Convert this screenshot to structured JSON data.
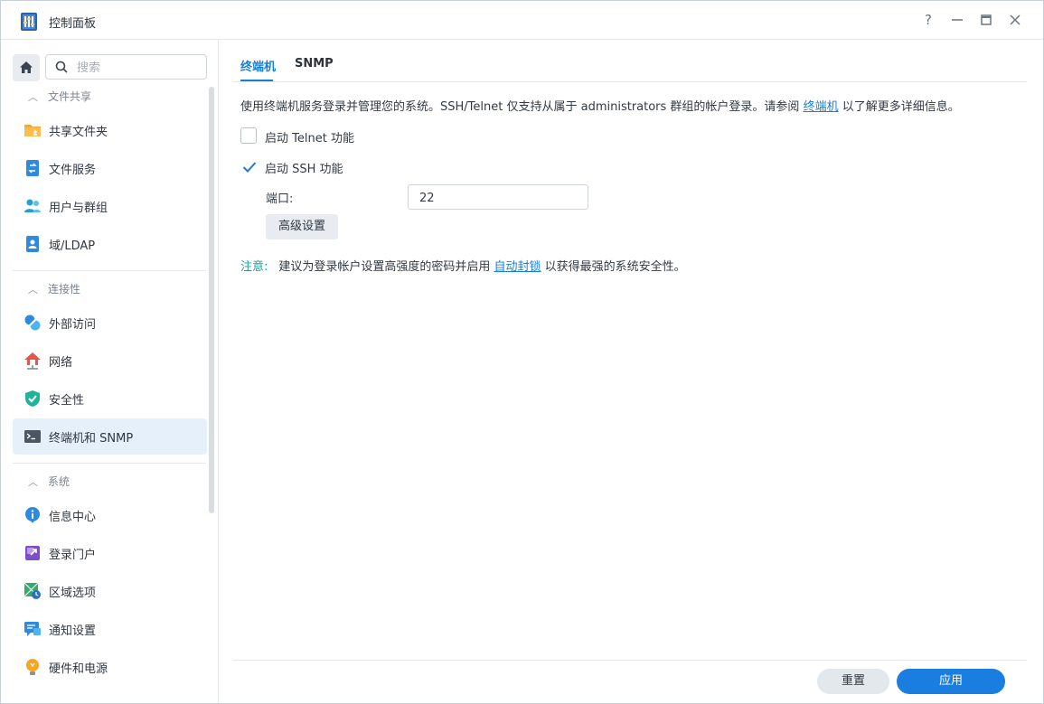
{
  "window": {
    "title": "控制面板",
    "controls": {
      "help": "?",
      "minimize": "—",
      "maximize": "□",
      "close": "✕"
    }
  },
  "sidebar": {
    "search_placeholder": "搜索",
    "groups": [
      {
        "label": "文件共享",
        "items": [
          {
            "label": "共享文件夹",
            "icon": "shared-folder-icon"
          },
          {
            "label": "文件服务",
            "icon": "file-services-icon"
          },
          {
            "label": "用户与群组",
            "icon": "users-groups-icon"
          },
          {
            "label": "域/LDAP",
            "icon": "domain-ldap-icon"
          }
        ]
      },
      {
        "label": "连接性",
        "items": [
          {
            "label": "外部访问",
            "icon": "external-access-icon"
          },
          {
            "label": "网络",
            "icon": "network-icon"
          },
          {
            "label": "安全性",
            "icon": "security-shield-icon"
          },
          {
            "label": "终端机和 SNMP",
            "icon": "terminal-icon",
            "active": true
          }
        ]
      },
      {
        "label": "系统",
        "items": [
          {
            "label": "信息中心",
            "icon": "info-center-icon"
          },
          {
            "label": "登录门户",
            "icon": "login-portal-icon"
          },
          {
            "label": "区域选项",
            "icon": "regional-options-icon"
          },
          {
            "label": "通知设置",
            "icon": "notification-icon"
          },
          {
            "label": "硬件和电源",
            "icon": "hardware-power-icon"
          }
        ]
      }
    ]
  },
  "tabs": [
    {
      "label": "终端机",
      "active": true
    },
    {
      "label": "SNMP",
      "active": false
    }
  ],
  "terminal": {
    "desc_before": "使用终端机服务登录并管理您的系统。SSH/Telnet 仅支持从属于 administrators 群组的帐户登录。请参阅 ",
    "desc_link": "终端机",
    "desc_after": " 以了解更多详细信息。",
    "telnet": {
      "label": "启动 Telnet 功能",
      "checked": false
    },
    "ssh": {
      "label": "启动 SSH 功能",
      "checked": true
    },
    "port_label": "端口:",
    "port_value": "22",
    "advanced_button": "高级设置",
    "note_label": "注意:",
    "note_before": "建议为登录帐户设置高强度的密码并启用 ",
    "note_link": "自动封锁",
    "note_after": " 以获得最强的系统安全性。"
  },
  "footer": {
    "reset": "重置",
    "apply": "应用"
  },
  "colors": {
    "accent": "#1a7dd6",
    "note": "#13a1a0",
    "active_bg": "#e6f0fb"
  }
}
